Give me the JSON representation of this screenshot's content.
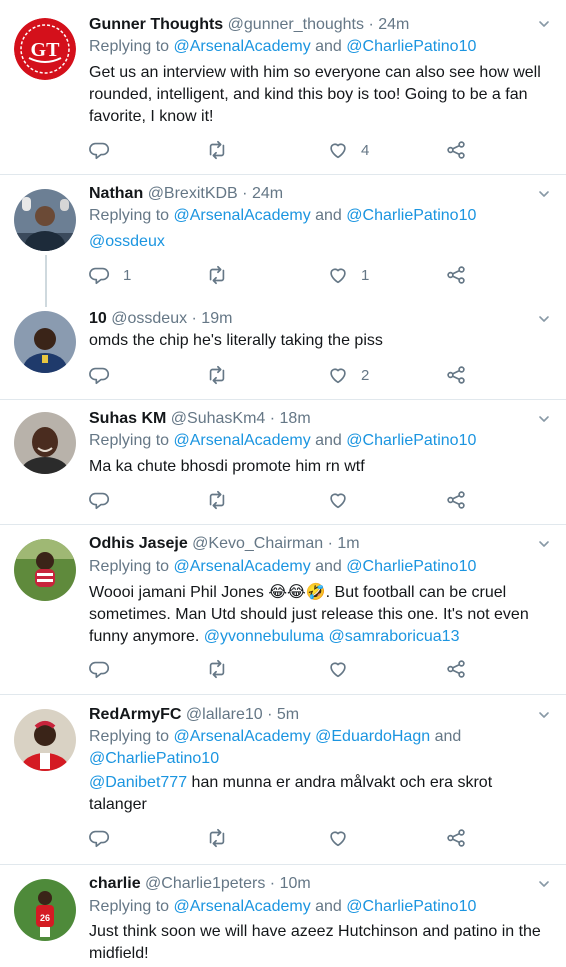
{
  "tweets": [
    {
      "name": "Gunner Thoughts",
      "meta": "@gunner_thoughts · 24m",
      "avatar": "gunner-thoughts-logo",
      "replying_prefix": "Replying to ",
      "replying_1": "@ArsenalAcademy",
      "replying_and": " and ",
      "replying_2": "@CharliePatino10",
      "text": "Get us an interview with him so everyone can also see how well rounded, intelligent, and kind this boy is too! Going to be a fan favorite, I know it!",
      "replies": "",
      "retweets": "",
      "likes": "4"
    },
    {
      "name": "Nathan",
      "meta": "@BrexitKDB · 24m",
      "avatar": "goalkeeper-photo",
      "replying_prefix": "Replying to ",
      "replying_1": "@ArsenalAcademy",
      "replying_and": " and ",
      "replying_2": "@CharliePatino10",
      "mention": "@ossdeux",
      "replies": "1",
      "retweets": "",
      "likes": "1"
    },
    {
      "name": "10",
      "meta": "@ossdeux · 19m",
      "avatar": "player-photo",
      "text": "omds the chip he's literally taking the piss",
      "replies": "",
      "retweets": "",
      "likes": "2"
    },
    {
      "name": "Suhas KM",
      "meta": "@SuhasKm4 · 18m",
      "avatar": "thierry-photo",
      "replying_prefix": "Replying to ",
      "replying_1": "@ArsenalAcademy",
      "replying_and": " and ",
      "replying_2": "@CharliePatino10",
      "text": "Ma ka chute bhosdi promote him rn wtf",
      "replies": "",
      "retweets": "",
      "likes": ""
    },
    {
      "name": "Odhis Jaseje",
      "meta": "@Kevo_Chairman · 1m",
      "avatar": "child-photo",
      "replying_prefix": "Replying to ",
      "replying_1": "@ArsenalAcademy",
      "replying_and": " and ",
      "replying_2": "@CharliePatino10",
      "text": "Woooi jamani Phil Jones 😂😂🤣. But football can be cruel sometimes. Man Utd should just release this one. It's not even funny anymore. ",
      "mention_1": "@yvonnebuluma",
      "mention_2": "@samraboricua13",
      "replies": "",
      "retweets": "",
      "likes": ""
    },
    {
      "name": "RedArmyFC",
      "meta": "@lallare10 · 5m",
      "avatar": "arsenal-fan-photo",
      "replying_prefix": "Replying to ",
      "replying_1": "@ArsenalAcademy",
      "replying_mid": "@EduardoHagn",
      "replying_and": " and ",
      "replying_2": "@CharliePatino10",
      "mention": "@Danibet777",
      "text": " han munna er andra målvakt och era skrot talanger",
      "replies": "",
      "retweets": "",
      "likes": ""
    },
    {
      "name": "charlie",
      "meta": "@Charlie1peters · 10m",
      "avatar": "arsenal-player-photo",
      "replying_prefix": "Replying to ",
      "replying_1": "@ArsenalAcademy",
      "replying_and": " and ",
      "replying_2": "@CharliePatino10",
      "text": "Just think soon we will have azeez Hutchinson and patino in the midfield!"
    }
  ],
  "colors": {
    "link": "#1b95e0",
    "muted": "#657786",
    "text": "#14171a",
    "separator": "#e1e8ed"
  }
}
